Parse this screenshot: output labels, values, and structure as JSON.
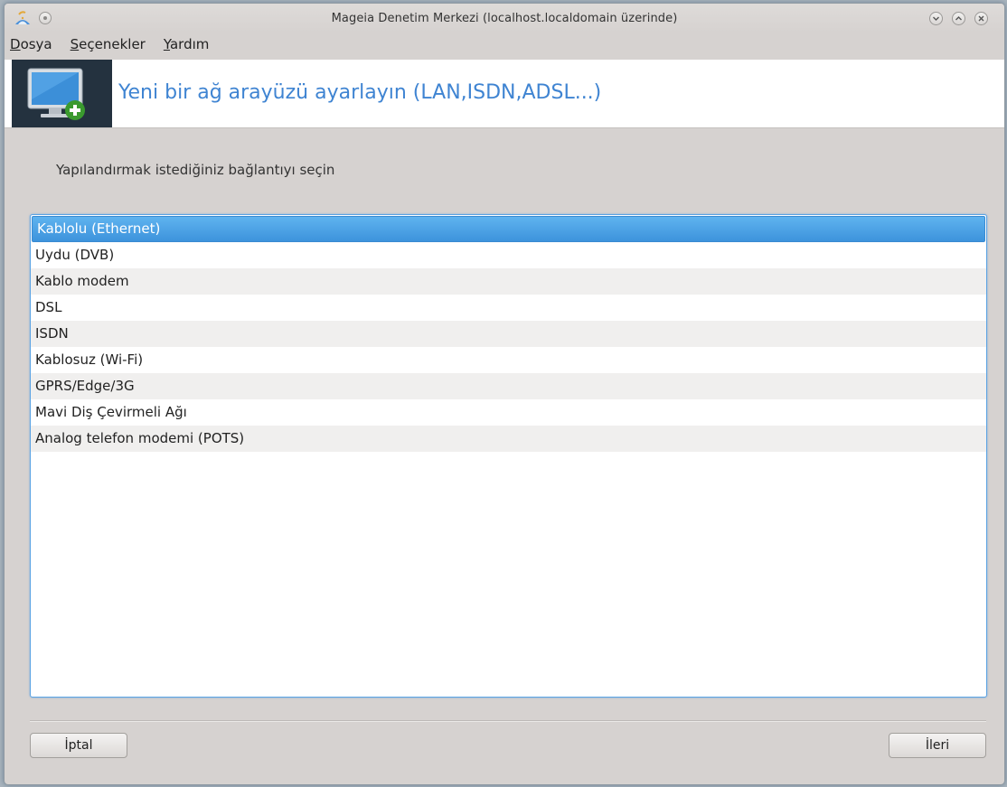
{
  "window": {
    "title": "Mageia Denetim Merkezi  (localhost.localdomain üzerinde)"
  },
  "menubar": {
    "items": [
      {
        "accel": "D",
        "rest": "osya"
      },
      {
        "accel": "S",
        "rest": "eçenekler"
      },
      {
        "accel": "Y",
        "rest": "ardım"
      }
    ]
  },
  "banner": {
    "title": "Yeni bir ağ arayüzü ayarlayın (LAN,ISDN,ADSL...)",
    "icon": "monitor-add-icon"
  },
  "prompt": "Yapılandırmak istediğiniz bağlantıyı seçin",
  "connections": {
    "selected_index": 0,
    "items": [
      "Kablolu (Ethernet)",
      "Uydu (DVB)",
      "Kablo modem",
      "DSL",
      "ISDN",
      "Kablosuz (Wi-Fi)",
      "GPRS/Edge/3G",
      "Mavi Diş Çevirmeli Ağı",
      "Analog telefon modemi (POTS)"
    ]
  },
  "buttons": {
    "cancel": "İptal",
    "next": "İleri"
  },
  "colors": {
    "accent": "#3f84d2",
    "selection": "#4aa1e6",
    "banner_icon_bg": "#24323f"
  }
}
